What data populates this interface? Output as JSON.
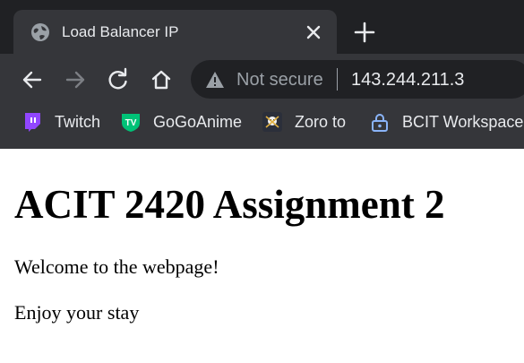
{
  "tab": {
    "title": "Load Balancer IP",
    "favicon": "globe-icon"
  },
  "toolbar": {
    "security_label": "Not secure",
    "url": "143.244.211.3"
  },
  "bookmarks": [
    {
      "label": "Twitch",
      "icon": "twitch-icon",
      "color": "#9146ff"
    },
    {
      "label": "GoGoAnime",
      "icon": "gogoanime-icon",
      "color": "#00c277"
    },
    {
      "label": "Zoro to",
      "icon": "zoro-icon",
      "color": "#2b2f3a"
    },
    {
      "label": "BCIT Workspace",
      "icon": "lock-icon",
      "color": "#8ab4f8"
    }
  ],
  "page": {
    "heading": "ACIT 2420 Assignment 2",
    "paragraphs": [
      "Welcome to the webpage!",
      "Enjoy your stay"
    ]
  },
  "colors": {
    "frame": "#202124",
    "toolbar": "#35363a",
    "text_light": "#e8eaed",
    "text_dim": "#9aa0a6"
  }
}
